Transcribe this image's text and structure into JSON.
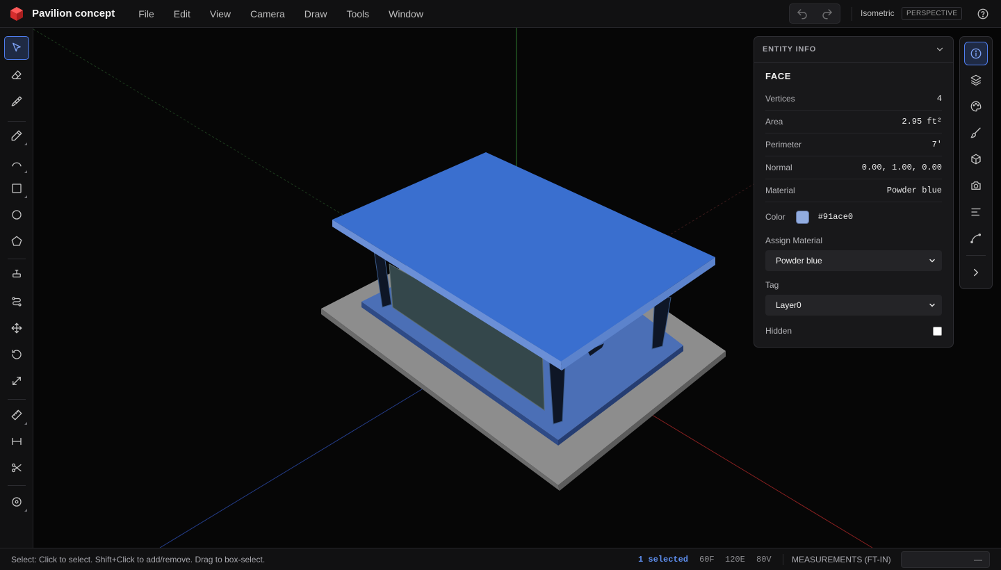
{
  "app": {
    "title": "Pavilion concept",
    "logo_icon": "red-cube-logo-icon"
  },
  "menu": [
    "File",
    "Edit",
    "View",
    "Camera",
    "Draw",
    "Tools",
    "Window"
  ],
  "topbar": {
    "undo_icon": "undo-icon",
    "redo_icon": "redo-icon",
    "view_name": "Isometric",
    "projection": "PERSPECTIVE",
    "help_icon": "help-icon"
  },
  "tools": [
    {
      "name": "select",
      "icon": "select-arrow-icon",
      "active": true
    },
    {
      "name": "eraser",
      "icon": "eraser-icon"
    },
    {
      "name": "paint-bucket",
      "icon": "paint-brush-icon"
    },
    {
      "name": "line",
      "icon": "pencil-icon",
      "submenu": true
    },
    {
      "name": "arc",
      "icon": "arc-icon",
      "submenu": true
    },
    {
      "name": "rectangle",
      "icon": "rectangle-icon",
      "submenu": true
    },
    {
      "name": "circle",
      "icon": "circle-icon"
    },
    {
      "name": "polygon",
      "icon": "pentagon-icon"
    },
    {
      "name": "push-pull",
      "icon": "push-pull-icon"
    },
    {
      "name": "follow-me",
      "icon": "follow-me-icon"
    },
    {
      "name": "move",
      "icon": "move-icon"
    },
    {
      "name": "rotate",
      "icon": "rotate-icon"
    },
    {
      "name": "scale",
      "icon": "scale-icon"
    },
    {
      "name": "tape-measure",
      "icon": "tape-measure-icon",
      "submenu": true
    },
    {
      "name": "dimension",
      "icon": "dimension-icon"
    },
    {
      "name": "section-cut",
      "icon": "scissors-icon"
    },
    {
      "name": "orbit",
      "icon": "orbit-icon",
      "submenu": true
    }
  ],
  "entity_info": {
    "panel_title": "ENTITY INFO",
    "entity_type": "FACE",
    "rows": [
      {
        "label": "Vertices",
        "value": "4"
      },
      {
        "label": "Area",
        "value": "2.95 ft²"
      },
      {
        "label": "Perimeter",
        "value": "7'"
      },
      {
        "label": "Normal",
        "value": "0.00, 1.00, 0.00"
      },
      {
        "label": "Material",
        "value": "Powder blue"
      }
    ],
    "color_label": "Color",
    "color_hex": "#91ace0",
    "assign_material_label": "Assign Material",
    "assign_material_value": "Powder blue",
    "tag_label": "Tag",
    "tag_value": "Layer0",
    "hidden_label": "Hidden",
    "hidden_checked": false
  },
  "right_rail": [
    {
      "icon": "info-icon",
      "active": true
    },
    {
      "icon": "layers-icon"
    },
    {
      "icon": "palette-icon"
    },
    {
      "icon": "brush-icon"
    },
    {
      "icon": "box-icon"
    },
    {
      "icon": "camera-icon"
    },
    {
      "icon": "align-left-icon"
    },
    {
      "icon": "curve-icon"
    },
    {
      "icon": "chevron-right-icon"
    }
  ],
  "status": {
    "hint": "Select: Click to select. Shift+Click to add/remove. Drag to box-select.",
    "selected": "1 selected",
    "faces": "60F",
    "edges": "120E",
    "vertices": "80V",
    "measurements_label": "MEASUREMENTS (FT-IN)",
    "measurements_value": "—"
  },
  "colors": {
    "accent": "#4f7ef0",
    "roof_blue": "#3a6fcf",
    "selected_face": "#91ace0",
    "base_gray": "#8d8d8d"
  }
}
